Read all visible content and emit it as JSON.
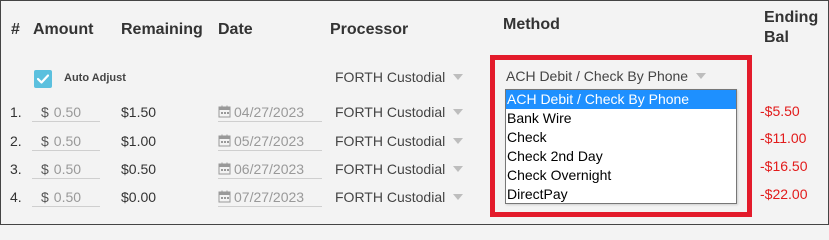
{
  "headers": {
    "num": "#",
    "amount": "Amount",
    "remaining": "Remaining",
    "date": "Date",
    "processor": "Processor",
    "method": "Method",
    "ending_line1": "Ending",
    "ending_line2": "Bal"
  },
  "auto_adjust": {
    "label": "Auto Adjust",
    "checked": true
  },
  "default_processor": "FORTH Custodial",
  "method_select": {
    "value": "ACH Debit / Check By Phone"
  },
  "method_options": [
    "ACH Debit / Check By Phone",
    "Bank Wire",
    "Check",
    "Check 2nd Day",
    "Check Overnight",
    "DirectPay"
  ],
  "selected_option_index": 0,
  "rows": [
    {
      "num": "1.",
      "currency": "$",
      "amount": "0.50",
      "remaining": "$1.50",
      "date": "04/27/2023",
      "processor": "FORTH Custodial",
      "ending": "-$5.50"
    },
    {
      "num": "2.",
      "currency": "$",
      "amount": "0.50",
      "remaining": "$1.00",
      "date": "05/27/2023",
      "processor": "FORTH Custodial",
      "ending": "-$11.00"
    },
    {
      "num": "3.",
      "currency": "$",
      "amount": "0.50",
      "remaining": "$0.50",
      "date": "06/27/2023",
      "processor": "FORTH Custodial",
      "ending": "-$16.50"
    },
    {
      "num": "4.",
      "currency": "$",
      "amount": "0.50",
      "remaining": "$0.00",
      "date": "07/27/2023",
      "processor": "FORTH Custodial",
      "ending": "-$22.00"
    }
  ],
  "colors": {
    "highlight_border": "#e31b2b",
    "negative_text": "#e21b1b",
    "checkbox": "#5bc0de",
    "selected_option": "#1e90ff"
  }
}
